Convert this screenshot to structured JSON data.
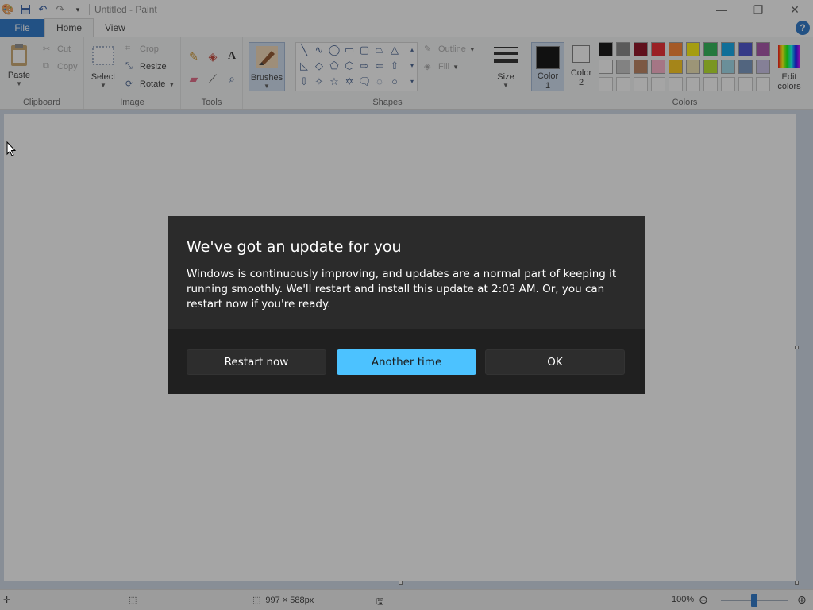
{
  "window": {
    "title": "Untitled - Paint",
    "controls": [
      "minimize",
      "restore",
      "close"
    ]
  },
  "tabs": {
    "file": "File",
    "home": "Home",
    "view": "View"
  },
  "ribbon": {
    "clipboard": {
      "label": "Clipboard",
      "paste": "Paste",
      "cut": "Cut",
      "copy": "Copy"
    },
    "image": {
      "label": "Image",
      "select": "Select",
      "crop": "Crop",
      "resize": "Resize",
      "rotate": "Rotate"
    },
    "tools": {
      "label": "Tools"
    },
    "brushes": {
      "label": "Brushes"
    },
    "shapes": {
      "label": "Shapes",
      "outline": "Outline",
      "fill": "Fill"
    },
    "size": {
      "label": "Size"
    },
    "color1": {
      "line1": "Color",
      "line2": "1"
    },
    "color2": {
      "line1": "Color",
      "line2": "2"
    },
    "colors": {
      "label": "Colors",
      "row1": [
        "#000000",
        "#7f7f7f",
        "#880015",
        "#ed1c24",
        "#ff7f27",
        "#fff200",
        "#22b14c",
        "#00a2e8",
        "#3f48cc",
        "#a349a4"
      ],
      "row2": [
        "#ffffff",
        "#c3c3c3",
        "#b97a57",
        "#ffaec9",
        "#ffc90e",
        "#efe4b0",
        "#b5e61d",
        "#99d9ea",
        "#7092be",
        "#c8bfe7"
      ]
    },
    "edit_colors": {
      "line1": "Edit",
      "line2": "colors"
    }
  },
  "status": {
    "canvas_size": "997 × 588px",
    "zoom": "100%"
  },
  "dialog": {
    "title": "We've got an update for you",
    "message": "Windows is continuously improving, and updates are a normal part of keeping it running smoothly. We'll restart and install this update at 2:03 AM. Or, you can restart now if you're ready.",
    "restart_now": "Restart now",
    "another_time": "Another time",
    "ok": "OK"
  }
}
